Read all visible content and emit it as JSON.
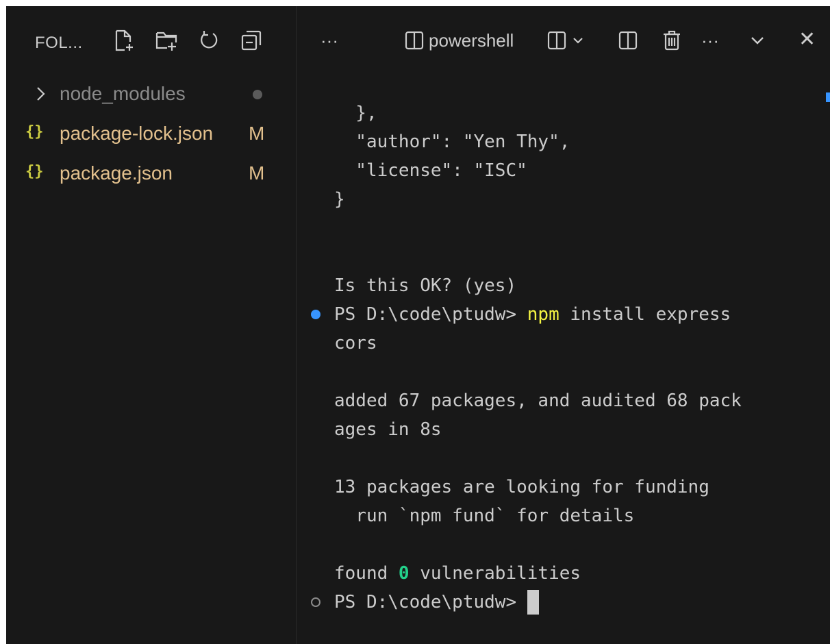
{
  "explorer": {
    "title": "FOL...",
    "actions": [
      {
        "icon": "new-file-icon"
      },
      {
        "icon": "new-folder-icon"
      },
      {
        "icon": "refresh-icon"
      },
      {
        "icon": "collapse-all-icon"
      }
    ],
    "items": [
      {
        "name": "node_modules",
        "type": "folder",
        "badge": ""
      },
      {
        "name": "package-lock.json",
        "type": "json",
        "badge": "M",
        "icon_text": "{}"
      },
      {
        "name": "package.json",
        "type": "json",
        "badge": "M",
        "icon_text": "{}"
      }
    ]
  },
  "panel": {
    "more_label": "···",
    "terminal_name": "powershell",
    "more2_label": "···",
    "close_label": "✕"
  },
  "terminal": {
    "lines": [
      "  },",
      "  \"author\": \"Yen Thy\",",
      "  \"license\": \"ISC\"",
      "}",
      "",
      "",
      "Is this OK? (yes)",
      "PS D:\\code\\ptudw> ",
      "npm",
      " install express",
      "cors",
      "",
      "added 67 packages, and audited 68 pack",
      "ages in 8s",
      "",
      "13 packages are looking for funding",
      "  run `npm fund` for details",
      "",
      "found ",
      "0",
      " vulnerabilities",
      "PS D:\\code\\ptudw> "
    ]
  },
  "colors": {
    "background": "#181818",
    "text": "#cccccc",
    "modified": "#e2c08d",
    "json_icon": "#cbcb41",
    "command_yellow": "#f5f543",
    "success_green": "#23d18b",
    "accent_blue": "#3794ff"
  }
}
